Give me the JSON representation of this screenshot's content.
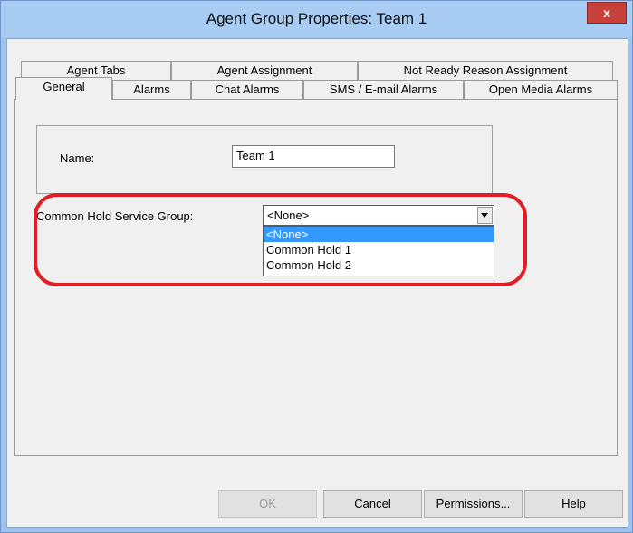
{
  "window": {
    "title": "Agent Group Properties: Team 1",
    "close_label": "x"
  },
  "tabs": {
    "back_row": [
      "Agent Tabs",
      "Agent Assignment",
      "Not Ready Reason Assignment"
    ],
    "front_row": [
      "General",
      "Alarms",
      "Chat Alarms",
      "SMS / E-mail Alarms",
      "Open Media Alarms"
    ],
    "selected": "General"
  },
  "form": {
    "name_label": "Name:",
    "name_value": "Team 1",
    "hold_label": "Common Hold Service Group:",
    "hold_value": "<None>",
    "hold_options": [
      "<None>",
      "Common Hold 1",
      "Common Hold 2"
    ],
    "hold_selected_index": 0
  },
  "buttons": {
    "ok": "OK",
    "cancel": "Cancel",
    "permissions": "Permissions...",
    "help": "Help"
  },
  "colors": {
    "window_frame": "#9ec3ee",
    "selection": "#3399ff",
    "highlight_ring": "#e01e25",
    "close_button": "#c8403a"
  }
}
